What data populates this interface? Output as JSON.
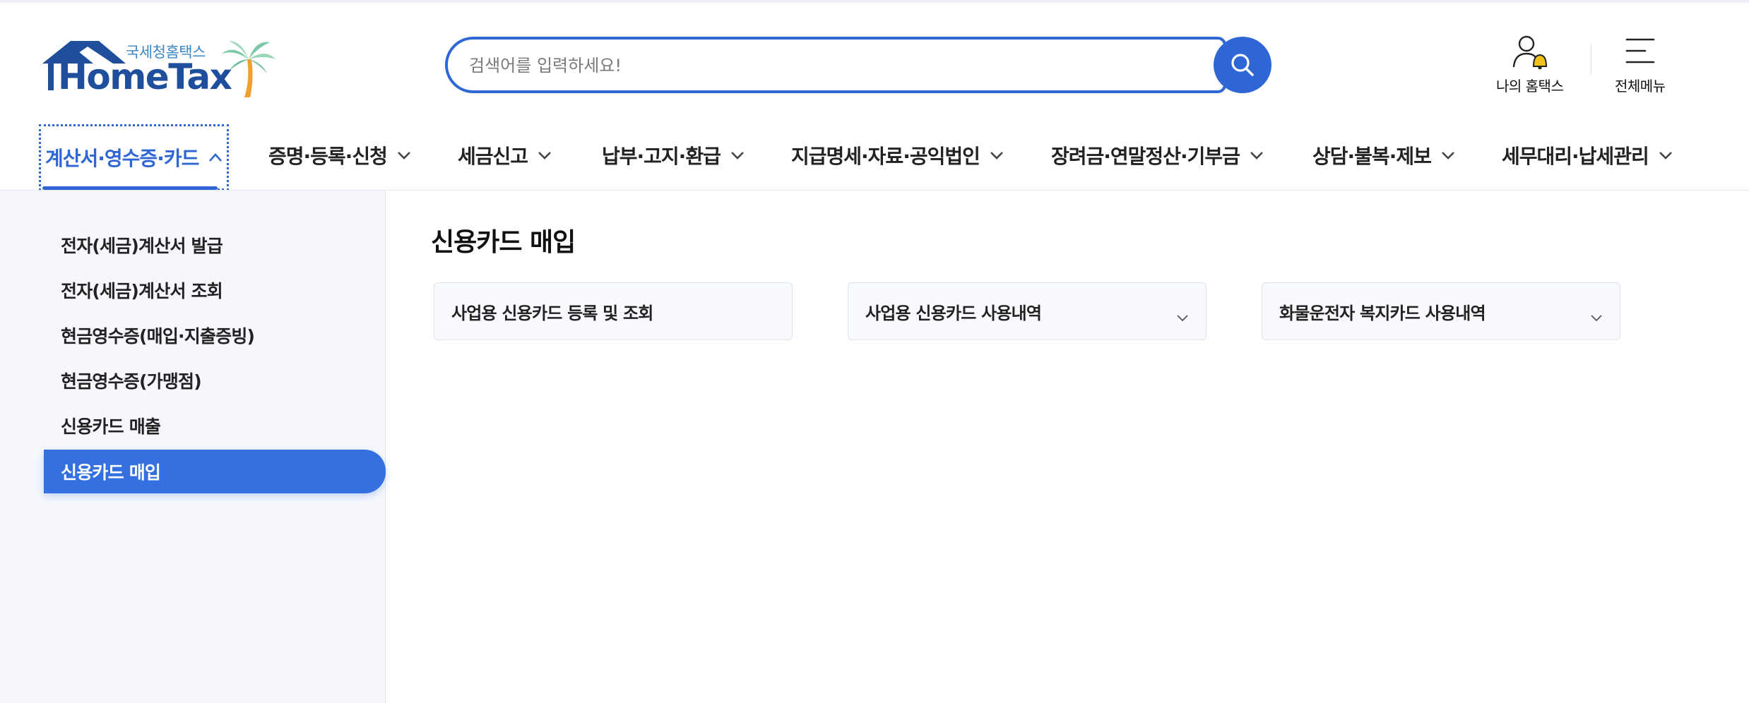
{
  "header": {
    "logo_sub": "국세청홈택스",
    "logo_main": "HomeTax",
    "search_placeholder": "검색어를 입력하세요!",
    "my_hometax_label": "나의 홈택스",
    "all_menu_label": "전체메뉴"
  },
  "gnb": {
    "items": [
      {
        "label": "계산서·영수증·카드",
        "active": true
      },
      {
        "label": "증명·등록·신청"
      },
      {
        "label": "세금신고"
      },
      {
        "label": "납부·고지·환급"
      },
      {
        "label": "지급명세·자료·공익법인"
      },
      {
        "label": "장려금·연말정산·기부금"
      },
      {
        "label": "상담·불복·제보"
      },
      {
        "label": "세무대리·납세관리"
      }
    ]
  },
  "side_menu": {
    "items": [
      {
        "label": "전자(세금)계산서 발급"
      },
      {
        "label": "전자(세금)계산서 조회"
      },
      {
        "label": "현금영수증(매입·지출증빙)"
      },
      {
        "label": "현금영수증(가맹점)"
      },
      {
        "label": "신용카드 매출"
      },
      {
        "label": "신용카드 매입",
        "active": true
      }
    ]
  },
  "main": {
    "title": "신용카드 매입",
    "cards": [
      {
        "label": "사업용 신용카드 등록 및 조회",
        "has_dropdown": false
      },
      {
        "label": "사업용 신용카드 사용내역",
        "has_dropdown": true
      },
      {
        "label": "화물운전자 복지카드 사용내역",
        "has_dropdown": true
      }
    ]
  },
  "colors": {
    "primary": "#2f66d6",
    "active_side": "#3470e0",
    "side_bg": "#f5f7fc",
    "logo_dark": "#1f4f9c",
    "logo_light": "#3b86c4",
    "bell": "#f2c21b"
  }
}
